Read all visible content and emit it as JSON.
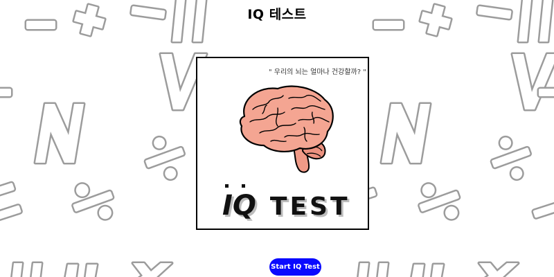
{
  "header": {
    "title": "IQ 테스트"
  },
  "background": {
    "icons": [
      "minus-symbol-icon",
      "plus-symbol-icon",
      "divide-symbol-icon",
      "letter-n-icon",
      "letter-v-icon",
      "letter-x-icon",
      "stroke-color-gray-icon"
    ],
    "symbol_color": "#9c9c9c"
  },
  "card": {
    "tagline": "\" 우리의 뇌는 얼마나 건강할까? \"",
    "image": "brain-icon",
    "logo_iq": "IQ",
    "logo_test": "TEST"
  },
  "actions": {
    "start_label": "Start IQ Test",
    "start_color": "#0a0aff"
  }
}
